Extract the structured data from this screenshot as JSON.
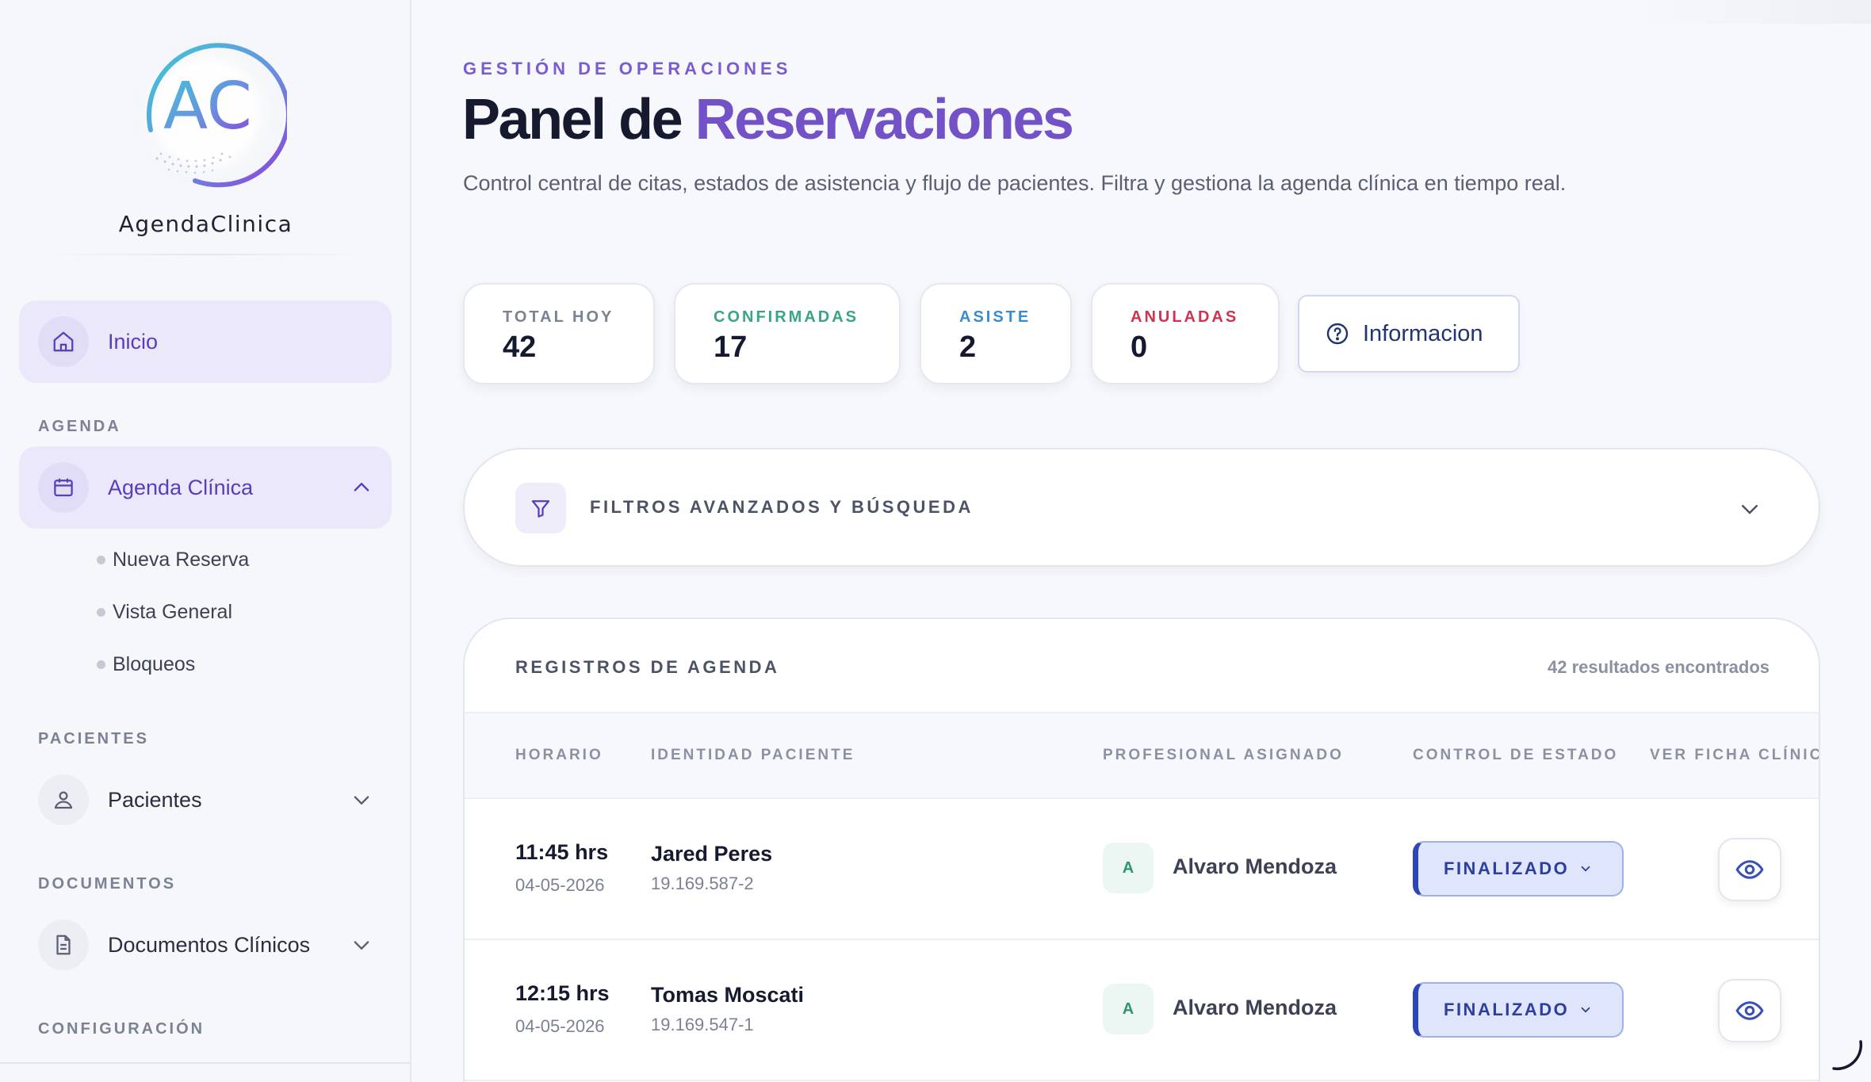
{
  "brand": {
    "logo_text": "AC",
    "name": "AgendaClinica"
  },
  "sidebar": {
    "home": {
      "label": "Inicio",
      "icon": "home-icon"
    },
    "sections": {
      "agenda": "AGENDA",
      "pacientes": "PACIENTES",
      "documentos": "DOCUMENTOS",
      "configuracion": "CONFIGURACIÓN"
    },
    "agenda_item": {
      "label": "Agenda Clínica",
      "icon": "calendar-icon",
      "expanded": true
    },
    "agenda_subitems": [
      "Nueva Reserva",
      "Vista General",
      "Bloqueos"
    ],
    "pacientes_item": {
      "label": "Pacientes",
      "icon": "patients-icon"
    },
    "documentos_item": {
      "label": "Documentos Clínicos",
      "icon": "document-icon"
    }
  },
  "header": {
    "eyebrow": "GESTIÓN DE OPERACIONES",
    "title_main": "Panel de ",
    "title_accent": "Reservaciones",
    "description": "Control central de citas, estados de asistencia y flujo de pacientes. Filtra y gestiona la agenda clínica en tiempo real."
  },
  "stats": [
    {
      "label": "TOTAL HOY",
      "value": "42",
      "color": "#7b8294"
    },
    {
      "label": "CONFIRMADAS",
      "value": "17",
      "color": "#3aa586"
    },
    {
      "label": "ASISTE",
      "value": "2",
      "color": "#3b8bd0"
    },
    {
      "label": "ANULADAS",
      "value": "0",
      "color": "#d0334f"
    }
  ],
  "info_button": {
    "label": "Informacion",
    "icon": "help-circle-icon"
  },
  "filters": {
    "label": "FILTROS AVANZADOS Y BÚSQUEDA",
    "icon": "filter-icon"
  },
  "records": {
    "title": "REGISTROS DE AGENDA",
    "count": "42 resultados encontrados",
    "columns": [
      "HORARIO",
      "IDENTIDAD PACIENTE",
      "PROFESIONAL ASIGNADO",
      "CONTROL DE ESTADO",
      "VER FICHA CLÍNICA"
    ],
    "rows": [
      {
        "time": "11:45 hrs",
        "date": "04-05-2026",
        "patient": "Jared Peres",
        "rut": "19.169.587-2",
        "avatar": "A",
        "professional": "Alvaro Mendoza",
        "status": "FINALIZADO"
      },
      {
        "time": "12:15 hrs",
        "date": "04-05-2026",
        "patient": "Tomas Moscati",
        "rut": "19.169.547-1",
        "avatar": "A",
        "professional": "Alvaro Mendoza",
        "status": "FINALIZADO"
      }
    ]
  },
  "colors": {
    "accent": "#7352c8",
    "status_primary": "#2c46b7",
    "sidebar_active": "#ece8fb"
  }
}
